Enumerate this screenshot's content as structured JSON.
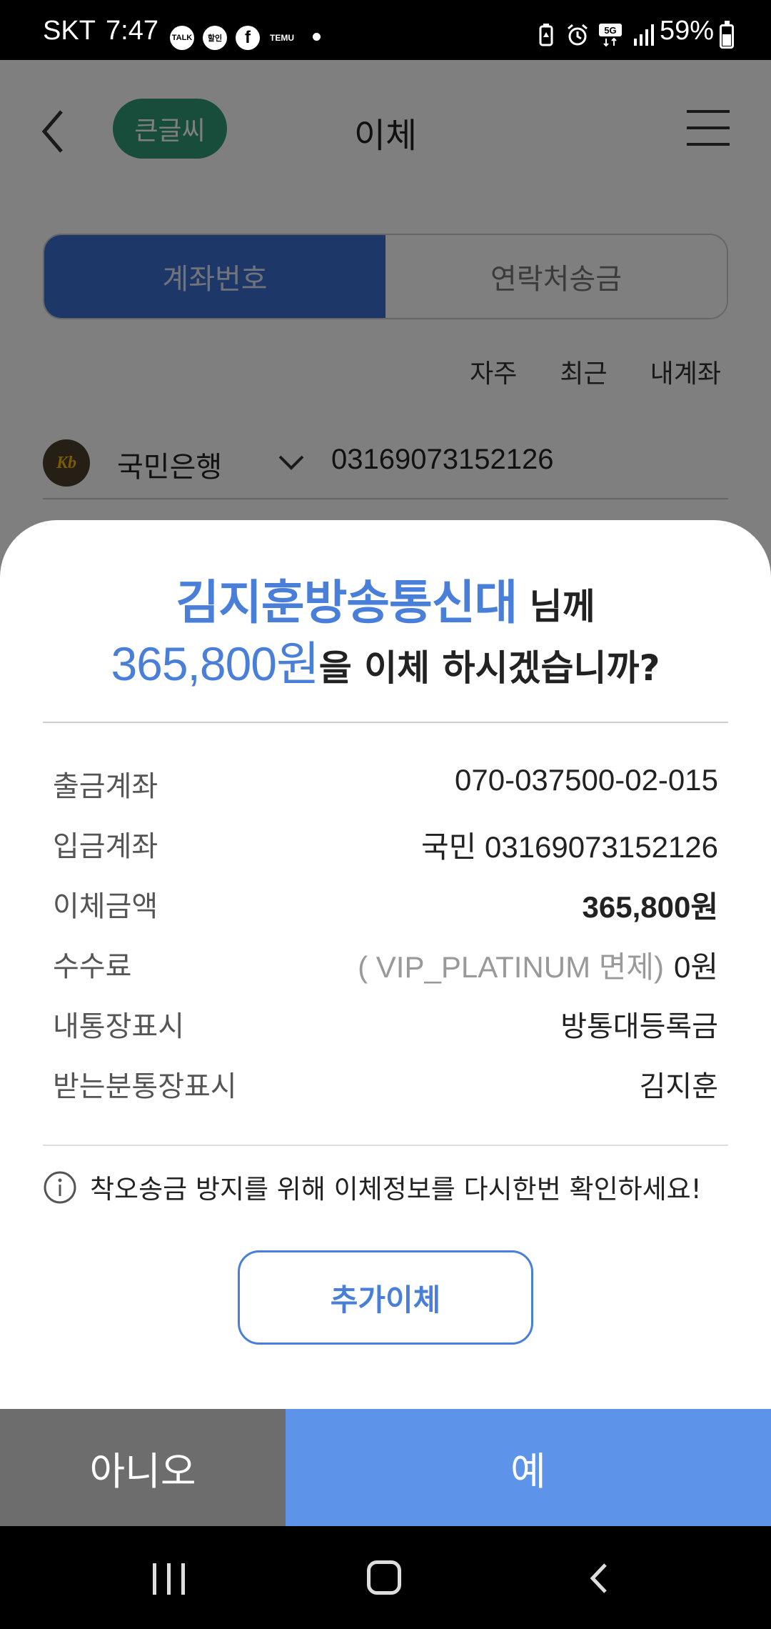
{
  "status_bar": {
    "carrier": "SKT",
    "time": "7:47",
    "notifications": [
      "TALK",
      "할인",
      "f",
      "TEMU"
    ],
    "battery": "59%",
    "network": "5G"
  },
  "app": {
    "big_font_button": "큰글씨",
    "title": "이체",
    "tabs": [
      {
        "label": "계좌번호",
        "active": true
      },
      {
        "label": "연락처송금",
        "active": false
      }
    ],
    "quick_links": [
      "자주",
      "최근",
      "내계좌"
    ],
    "bank": {
      "logo_text": "Kb",
      "name": "국민은행",
      "account_number": "03169073152126"
    }
  },
  "dialog": {
    "recipient": "김지훈방송통신대",
    "recipient_suffix": " 님께",
    "amount": "365,800원",
    "question": "을 이체 하시겠습니까?",
    "rows": [
      {
        "label": "출금계좌",
        "value": "070-037500-02-015"
      },
      {
        "label": "입금계좌",
        "value": "국민 03169073152126"
      },
      {
        "label": "이체금액",
        "value": "365,800원"
      },
      {
        "label": "수수료",
        "note": "( VIP_PLATINUM 면제)",
        "value": "0원"
      },
      {
        "label": "내통장표시",
        "value": "방통대등록금"
      },
      {
        "label": "받는분통장표시",
        "value": "김지훈"
      }
    ],
    "notice": "착오송금 방지를 위해 이체정보를 다시한번 확인하세요!",
    "add_transfer_button": "추가이체",
    "no_button": "아니오",
    "yes_button": "예",
    "accent_color": "#4a7fd9",
    "yes_color": "#5d93e9",
    "no_color": "#6d6d6d"
  }
}
